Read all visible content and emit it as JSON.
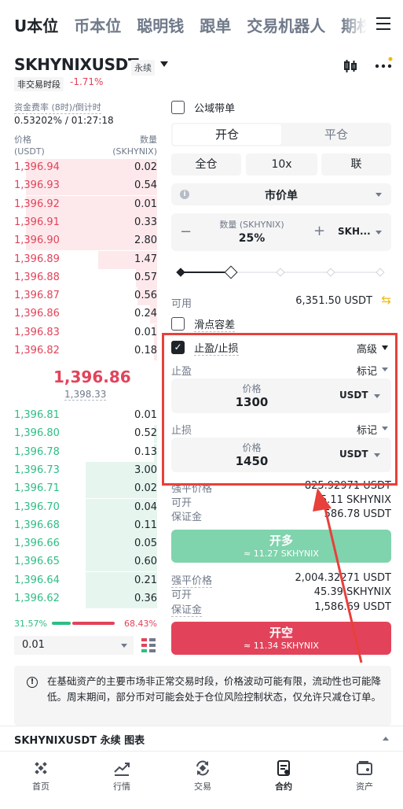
{
  "top_tabs": [
    "U本位",
    "币本位",
    "聪明钱",
    "跟单",
    "交易机器人",
    "期权"
  ],
  "header": {
    "symbol": "SKHYNIXUSDT",
    "contract": "永续",
    "session": "非交易时段",
    "change": "-1.71%"
  },
  "funding": {
    "label": "资金费率 (8时)/倒计时",
    "value": "0.53202% / 01:27:18"
  },
  "orderbook": {
    "price_label": "价格",
    "qty_label": "数量",
    "price_unit": "(USDT)",
    "qty_unit": "(SKHYNIX)",
    "asks": [
      {
        "p": "1,396.94",
        "q": "0.02",
        "d": 0.92
      },
      {
        "p": "1,396.93",
        "q": "0.54",
        "d": 0.92
      },
      {
        "p": "1,396.92",
        "q": "0.01",
        "d": 0.92
      },
      {
        "p": "1,396.91",
        "q": "0.33",
        "d": 0.92
      },
      {
        "p": "1,396.90",
        "q": "2.80",
        "d": 0.92
      },
      {
        "p": "1,396.89",
        "q": "1.47",
        "d": 0.41
      },
      {
        "p": "1,396.88",
        "q": "0.57",
        "d": 0.15
      },
      {
        "p": "1,396.87",
        "q": "0.56",
        "d": 0.14
      },
      {
        "p": "1,396.86",
        "q": "0.24",
        "d": 0.05
      },
      {
        "p": "1,396.83",
        "q": "0.01",
        "d": 0.02
      },
      {
        "p": "1,396.82",
        "q": "0.18",
        "d": 0.02
      }
    ],
    "mid": "1,396.86",
    "mid_ref": "1,398.33",
    "bids": [
      {
        "p": "1,396.81",
        "q": "0.01",
        "d": 0
      },
      {
        "p": "1,396.80",
        "q": "0.52",
        "d": 0.02
      },
      {
        "p": "1,396.78",
        "q": "0.13",
        "d": 0.02
      },
      {
        "p": "1,396.73",
        "q": "3.00",
        "d": 0.5
      },
      {
        "p": "1,396.71",
        "q": "0.02",
        "d": 0.5
      },
      {
        "p": "1,396.70",
        "q": "0.04",
        "d": 0.5
      },
      {
        "p": "1,396.68",
        "q": "0.11",
        "d": 0.5
      },
      {
        "p": "1,396.66",
        "q": "0.05",
        "d": 0.5
      },
      {
        "p": "1,396.65",
        "q": "0.60",
        "d": 0.5
      },
      {
        "p": "1,396.64",
        "q": "0.21",
        "d": 0.5
      },
      {
        "p": "1,396.62",
        "q": "0.36",
        "d": 0.5
      }
    ],
    "buy_pct": "31.57%",
    "sell_pct": "68.43%",
    "buy_ratio": 0.3157,
    "precision": "0.01"
  },
  "form": {
    "public_label": "公域带单",
    "open_tab": "开仓",
    "close_tab": "平仓",
    "margin_mode": "全仓",
    "leverage": "10x",
    "mode": "联",
    "order_type": "市价单",
    "qty_label": "数量 (SKHYNIX)",
    "qty_value": "25%",
    "qty_unit": "SKH...",
    "slider_fraction": 0.25,
    "avail_label": "可用",
    "avail_value": "6,351.50 USDT",
    "slippage_label": "滑点容差",
    "tpsl_label": "止盈/止损",
    "advanced": "高级",
    "tp_label": "止盈",
    "tp_mark": "标记",
    "tp_price_label": "价格",
    "tp_price": "1300",
    "tp_unit": "USDT",
    "sl_label": "止损",
    "sl_mark": "标记",
    "sl_price_label": "价格",
    "sl_price": "1450",
    "sl_unit": "USDT",
    "long": {
      "liq_label": "强平价格",
      "liq_value": "825.92971 USDT",
      "open_label": "可开",
      "open_value": "5.11 SKHYNIX",
      "margin_label": "保证金",
      "margin_value": "586.78 USDT"
    },
    "long_btn": "开多",
    "long_btn_sub": "≈ 11.27 SKHYNIX",
    "short": {
      "liq_label": "强平价格",
      "liq_value": "2,004.32271 USDT",
      "open_label": "可开",
      "open_value": "45.39 SKHYNIX",
      "margin_label": "保证金",
      "margin_value": "1,586.69 USDT"
    },
    "short_btn": "开空",
    "short_btn_sub": "≈ 11.34 SKHYNIX"
  },
  "notice": "在基础资产的主要市场非正常交易时段，价格波动可能有限，流动性也可能降低。周末期间，部分币对可能会处于仓位风险控制状态，仅允许只减仓订单。",
  "chart_bar": "SKHYNIXUSDT 永续 图表",
  "nav": [
    "首页",
    "行情",
    "交易",
    "合约",
    "资产"
  ],
  "colors": {
    "buy": "#2ebd85",
    "sell": "#e2435a",
    "annotation": "#e8403b"
  }
}
